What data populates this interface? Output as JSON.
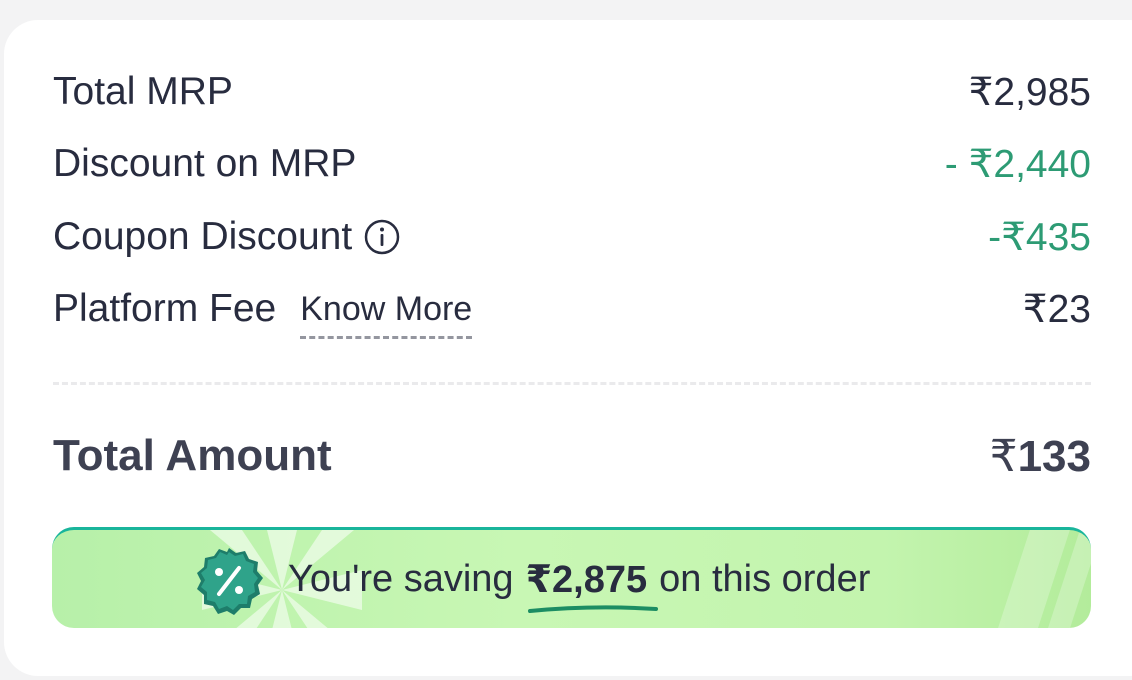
{
  "rows": {
    "total_mrp": {
      "label": "Total MRP",
      "value": "₹2,985"
    },
    "discount": {
      "label": "Discount on MRP",
      "value": "- ₹2,440"
    },
    "coupon": {
      "label": "Coupon Discount",
      "value": "-₹435"
    },
    "platform": {
      "label": "Platform Fee",
      "link": "Know More",
      "value": "₹23"
    }
  },
  "total": {
    "label": "Total Amount",
    "currency": "₹",
    "amount": "133"
  },
  "savings": {
    "prefix": "You're saving",
    "amount": "₹2,875",
    "suffix": "on this order",
    "badge_icon": "percent-badge-icon"
  },
  "colors": {
    "green_text": "#2d9b74",
    "banner_start": "#b7f0a9",
    "banner_border": "#19b59b",
    "text_dark": "#282c3f"
  }
}
